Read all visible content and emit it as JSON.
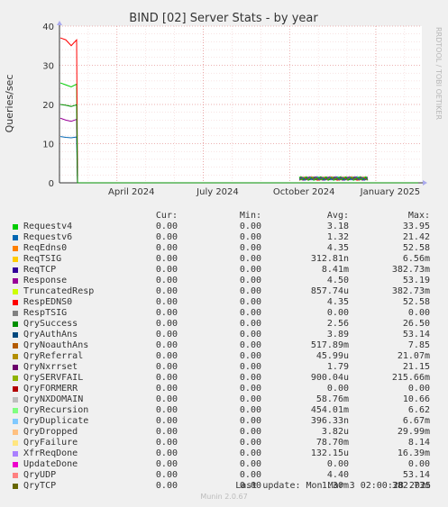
{
  "chart_data": {
    "type": "line",
    "title": "BIND [02] Server Stats - by year",
    "ylabel": "Queries/sec",
    "ylim": [
      0,
      40
    ],
    "yticks": [
      0,
      10,
      20,
      30,
      40
    ],
    "xticks": [
      "April 2024",
      "July 2024",
      "October 2024",
      "January 2025"
    ],
    "grid": true,
    "watermark": "RRDTOOL / TOBI OETIKER",
    "series": [
      {
        "name": "Requestv4",
        "color": "#00cc00",
        "values": [
          25.5,
          25.0,
          24.5,
          25.2,
          0
        ]
      },
      {
        "name": "Requestv6",
        "color": "#0066b3",
        "values": [
          11.8,
          11.6,
          11.5,
          11.7,
          0
        ]
      },
      {
        "name": "Response",
        "color": "#990099",
        "values": [
          16.5,
          16.0,
          15.7,
          16.2,
          0
        ]
      },
      {
        "name": "RespEDNS0",
        "color": "#ff0000",
        "values": [
          37.0,
          36.5,
          35.0,
          36.5,
          0
        ]
      },
      {
        "name": "QrySuccess",
        "color": "#008f00",
        "values": [
          20.0,
          19.8,
          19.5,
          19.9,
          0
        ]
      }
    ]
  },
  "legend": {
    "headers": [
      "Cur:",
      "Min:",
      "Avg:",
      "Max:"
    ],
    "rows": [
      {
        "name": "Requestv4",
        "color": "#00cc00",
        "cur": "0.00",
        "min": "0.00",
        "avg": "3.18",
        "max": "33.95"
      },
      {
        "name": "Requestv6",
        "color": "#0066b3",
        "cur": "0.00",
        "min": "0.00",
        "avg": "1.32",
        "max": "21.42"
      },
      {
        "name": "ReqEdns0",
        "color": "#ff8000",
        "cur": "0.00",
        "min": "0.00",
        "avg": "4.35",
        "max": "52.58"
      },
      {
        "name": "ReqTSIG",
        "color": "#ffcc00",
        "cur": "0.00",
        "min": "0.00",
        "avg": "312.81n",
        "max": "6.56m"
      },
      {
        "name": "ReqTCP",
        "color": "#330099",
        "cur": "0.00",
        "min": "0.00",
        "avg": "8.41m",
        "max": "382.73m"
      },
      {
        "name": "Response",
        "color": "#990099",
        "cur": "0.00",
        "min": "0.00",
        "avg": "4.50",
        "max": "53.19"
      },
      {
        "name": "TruncatedResp",
        "color": "#ccff00",
        "cur": "0.00",
        "min": "0.00",
        "avg": "857.74u",
        "max": "382.73m"
      },
      {
        "name": "RespEDNS0",
        "color": "#ff0000",
        "cur": "0.00",
        "min": "0.00",
        "avg": "4.35",
        "max": "52.58"
      },
      {
        "name": "RespTSIG",
        "color": "#808080",
        "cur": "0.00",
        "min": "0.00",
        "avg": "0.00",
        "max": "0.00"
      },
      {
        "name": "QrySuccess",
        "color": "#008f00",
        "cur": "0.00",
        "min": "0.00",
        "avg": "2.56",
        "max": "26.50"
      },
      {
        "name": "QryAuthAns",
        "color": "#00487d",
        "cur": "0.00",
        "min": "0.00",
        "avg": "3.89",
        "max": "53.14"
      },
      {
        "name": "QryNoauthAns",
        "color": "#b35a00",
        "cur": "0.00",
        "min": "0.00",
        "avg": "517.89m",
        "max": "7.85"
      },
      {
        "name": "QryReferral",
        "color": "#b38f00",
        "cur": "0.00",
        "min": "0.00",
        "avg": "45.99u",
        "max": "21.07m"
      },
      {
        "name": "QryNxrrset",
        "color": "#6b006b",
        "cur": "0.00",
        "min": "0.00",
        "avg": "1.79",
        "max": "21.15"
      },
      {
        "name": "QrySERVFAIL",
        "color": "#8fb300",
        "cur": "0.00",
        "min": "0.00",
        "avg": "900.04u",
        "max": "215.66m"
      },
      {
        "name": "QryFORMERR",
        "color": "#b30000",
        "cur": "0.00",
        "min": "0.00",
        "avg": "0.00",
        "max": "0.00"
      },
      {
        "name": "QryNXDOMAIN",
        "color": "#bebebe",
        "cur": "0.00",
        "min": "0.00",
        "avg": "58.76m",
        "max": "10.66"
      },
      {
        "name": "QryRecursion",
        "color": "#80ff80",
        "cur": "0.00",
        "min": "0.00",
        "avg": "454.01m",
        "max": "6.62"
      },
      {
        "name": "QryDuplicate",
        "color": "#80c9ff",
        "cur": "0.00",
        "min": "0.00",
        "avg": "396.33n",
        "max": "6.67m"
      },
      {
        "name": "QryDropped",
        "color": "#ffc080",
        "cur": "0.00",
        "min": "0.00",
        "avg": "3.82u",
        "max": "29.99m"
      },
      {
        "name": "QryFailure",
        "color": "#ffe680",
        "cur": "0.00",
        "min": "0.00",
        "avg": "78.70m",
        "max": "8.14"
      },
      {
        "name": "XfrReqDone",
        "color": "#aa80ff",
        "cur": "0.00",
        "min": "0.00",
        "avg": "132.15u",
        "max": "16.39m"
      },
      {
        "name": "UpdateDone",
        "color": "#ee00cc",
        "cur": "0.00",
        "min": "0.00",
        "avg": "0.00",
        "max": "0.00"
      },
      {
        "name": "QryUDP",
        "color": "#ff8080",
        "cur": "0.00",
        "min": "0.00",
        "avg": "4.40",
        "max": "53.14"
      },
      {
        "name": "QryTCP",
        "color": "#666600",
        "cur": "0.00",
        "min": "0.00",
        "avg": "1.30m",
        "max": "382.73m"
      }
    ]
  },
  "footer": {
    "last_update": "Last update: Mon Mar  3 02:00:28 2025",
    "munin_version": "Munin 2.0.67"
  }
}
